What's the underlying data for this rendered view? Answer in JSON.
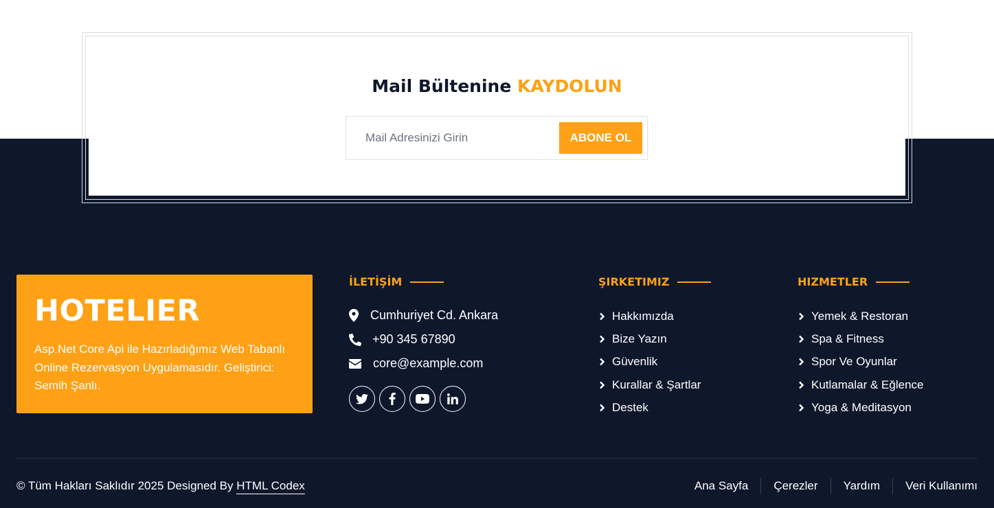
{
  "newsletter": {
    "title_main": "Mail Bültenine",
    "title_accent": "KAYDOLUN",
    "placeholder": "Mail Adresinizi Girin",
    "button_label": "ABONE OL"
  },
  "brand": {
    "title": "HOTELIER",
    "description": "Asp.Net Core Api ile Hazırladığımız Web Tabanlı Online Rezervasyon Uygulamasıdır. Geliştirici: Semih Şanlı."
  },
  "contact": {
    "heading": "İLETİŞİM",
    "address": "Cumhuriyet Cd. Ankara",
    "phone": "+90 345 67890",
    "email": "core@example.com",
    "socials": [
      "twitter-icon",
      "facebook-icon",
      "youtube-icon",
      "linkedin-icon"
    ]
  },
  "company": {
    "heading": "ŞIRKETIMIZ",
    "links": [
      "Hakkımızda",
      "Bize Yazın",
      "Güvenlik",
      "Kurallar & Şartlar",
      "Destek"
    ]
  },
  "services": {
    "heading": "HIZMETLER",
    "links": [
      "Yemek & Restoran",
      "Spa & Fitness",
      "Spor Ve Oyunlar",
      "Kutlamalar & Eğlence",
      "Yoga & Meditasyon"
    ]
  },
  "footer": {
    "copyright_prefix": "© Tüm Hakları Saklıdır 2025 Designed By",
    "copyright_link": "HTML Codex",
    "menu": [
      "Ana Sayfa",
      "Çerezler",
      "Yardım",
      "Veri Kullanımı"
    ]
  },
  "colors": {
    "accent": "#fea116",
    "dark": "#0f172b",
    "white": "#ffffff"
  }
}
